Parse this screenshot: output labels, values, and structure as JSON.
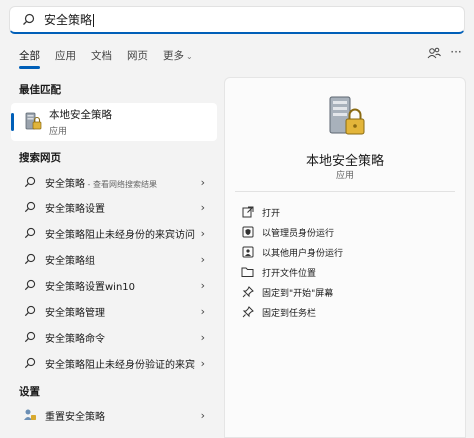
{
  "search": {
    "value": "安全策略"
  },
  "tabs": [
    {
      "label": "全部"
    },
    {
      "label": "应用"
    },
    {
      "label": "文档"
    },
    {
      "label": "网页"
    },
    {
      "label": "更多"
    }
  ],
  "best_match": {
    "heading": "最佳匹配",
    "name": "本地安全策略",
    "type": "应用"
  },
  "web": {
    "heading": "搜索网页",
    "items": [
      {
        "label": "安全策略",
        "sub": " - 查看网络搜索结果"
      },
      {
        "label": "安全策略设置"
      },
      {
        "label": "安全策略阻止未经身份的来宾访问"
      },
      {
        "label": "安全策略组"
      },
      {
        "label": "安全策略设置win10"
      },
      {
        "label": "安全策略管理"
      },
      {
        "label": "安全策略命令"
      },
      {
        "label": "安全策略阻止未经身份验证的来宾"
      }
    ]
  },
  "settings": {
    "heading": "设置",
    "items": [
      {
        "label": "重置安全策略"
      }
    ]
  },
  "panel": {
    "title": "本地安全策略",
    "subtitle": "应用",
    "actions": [
      {
        "label": "打开",
        "icon": "open-icon"
      },
      {
        "label": "以管理员身份运行",
        "icon": "admin-shield-icon"
      },
      {
        "label": "以其他用户身份运行",
        "icon": "other-user-icon"
      },
      {
        "label": "打开文件位置",
        "icon": "folder-icon"
      },
      {
        "label": "固定到\"开始\"屏幕",
        "icon": "pin-icon"
      },
      {
        "label": "固定到任务栏",
        "icon": "pin-icon"
      }
    ]
  },
  "colors": {
    "accent": "#005fb8",
    "background": "#f3f3f3"
  }
}
